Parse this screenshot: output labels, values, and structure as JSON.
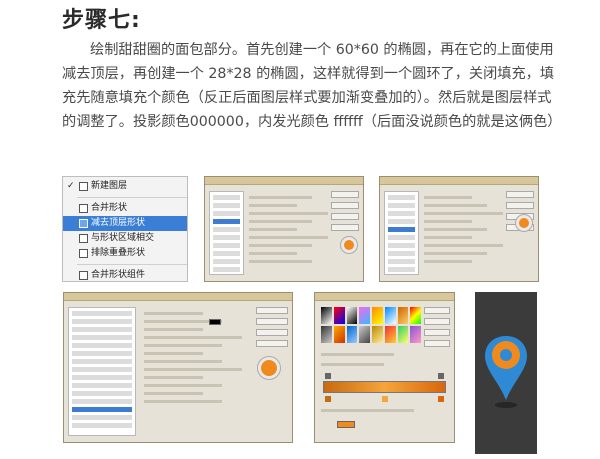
{
  "step": {
    "title": "步骤七:"
  },
  "paragraph": {
    "text": "绘制甜甜圈的面包部分。首先创建一个 60*60 的椭圆，再在它的上面使用减去顶层，再创建一个 28*28 的椭圆，这样就得到一个圆环了，关闭填充，填充先随意填充个颜色（反正后面图层样式要加渐变叠加的）。然后就是图层样式的调整了。投影颜色000000，内发光颜色 ffffff（后面没说颜色的就是这俩色）"
  },
  "menu": {
    "items": [
      {
        "label": "新建图层",
        "checked": true,
        "selected": false
      },
      {
        "label": "合并形状",
        "checked": false,
        "selected": false
      },
      {
        "label": "减去顶层形状",
        "checked": false,
        "selected": true
      },
      {
        "label": "与形状区域相交",
        "checked": false,
        "selected": false
      },
      {
        "label": "排除重叠形状",
        "checked": false,
        "selected": false
      },
      {
        "label": "合并形状组件",
        "checked": false,
        "selected": false
      }
    ],
    "check_glyph": "✓"
  },
  "colors": {
    "selected_menu": "#3a7fd5",
    "donut_orange": "#f08a1c",
    "pin_blue": "#2f8ad6",
    "pin_ring": "#f08a1c",
    "pin_panel": "#3b3b3b"
  },
  "icons": {
    "menu_item_icon": "shape-combine-icon",
    "pin": "map-pin-icon"
  }
}
